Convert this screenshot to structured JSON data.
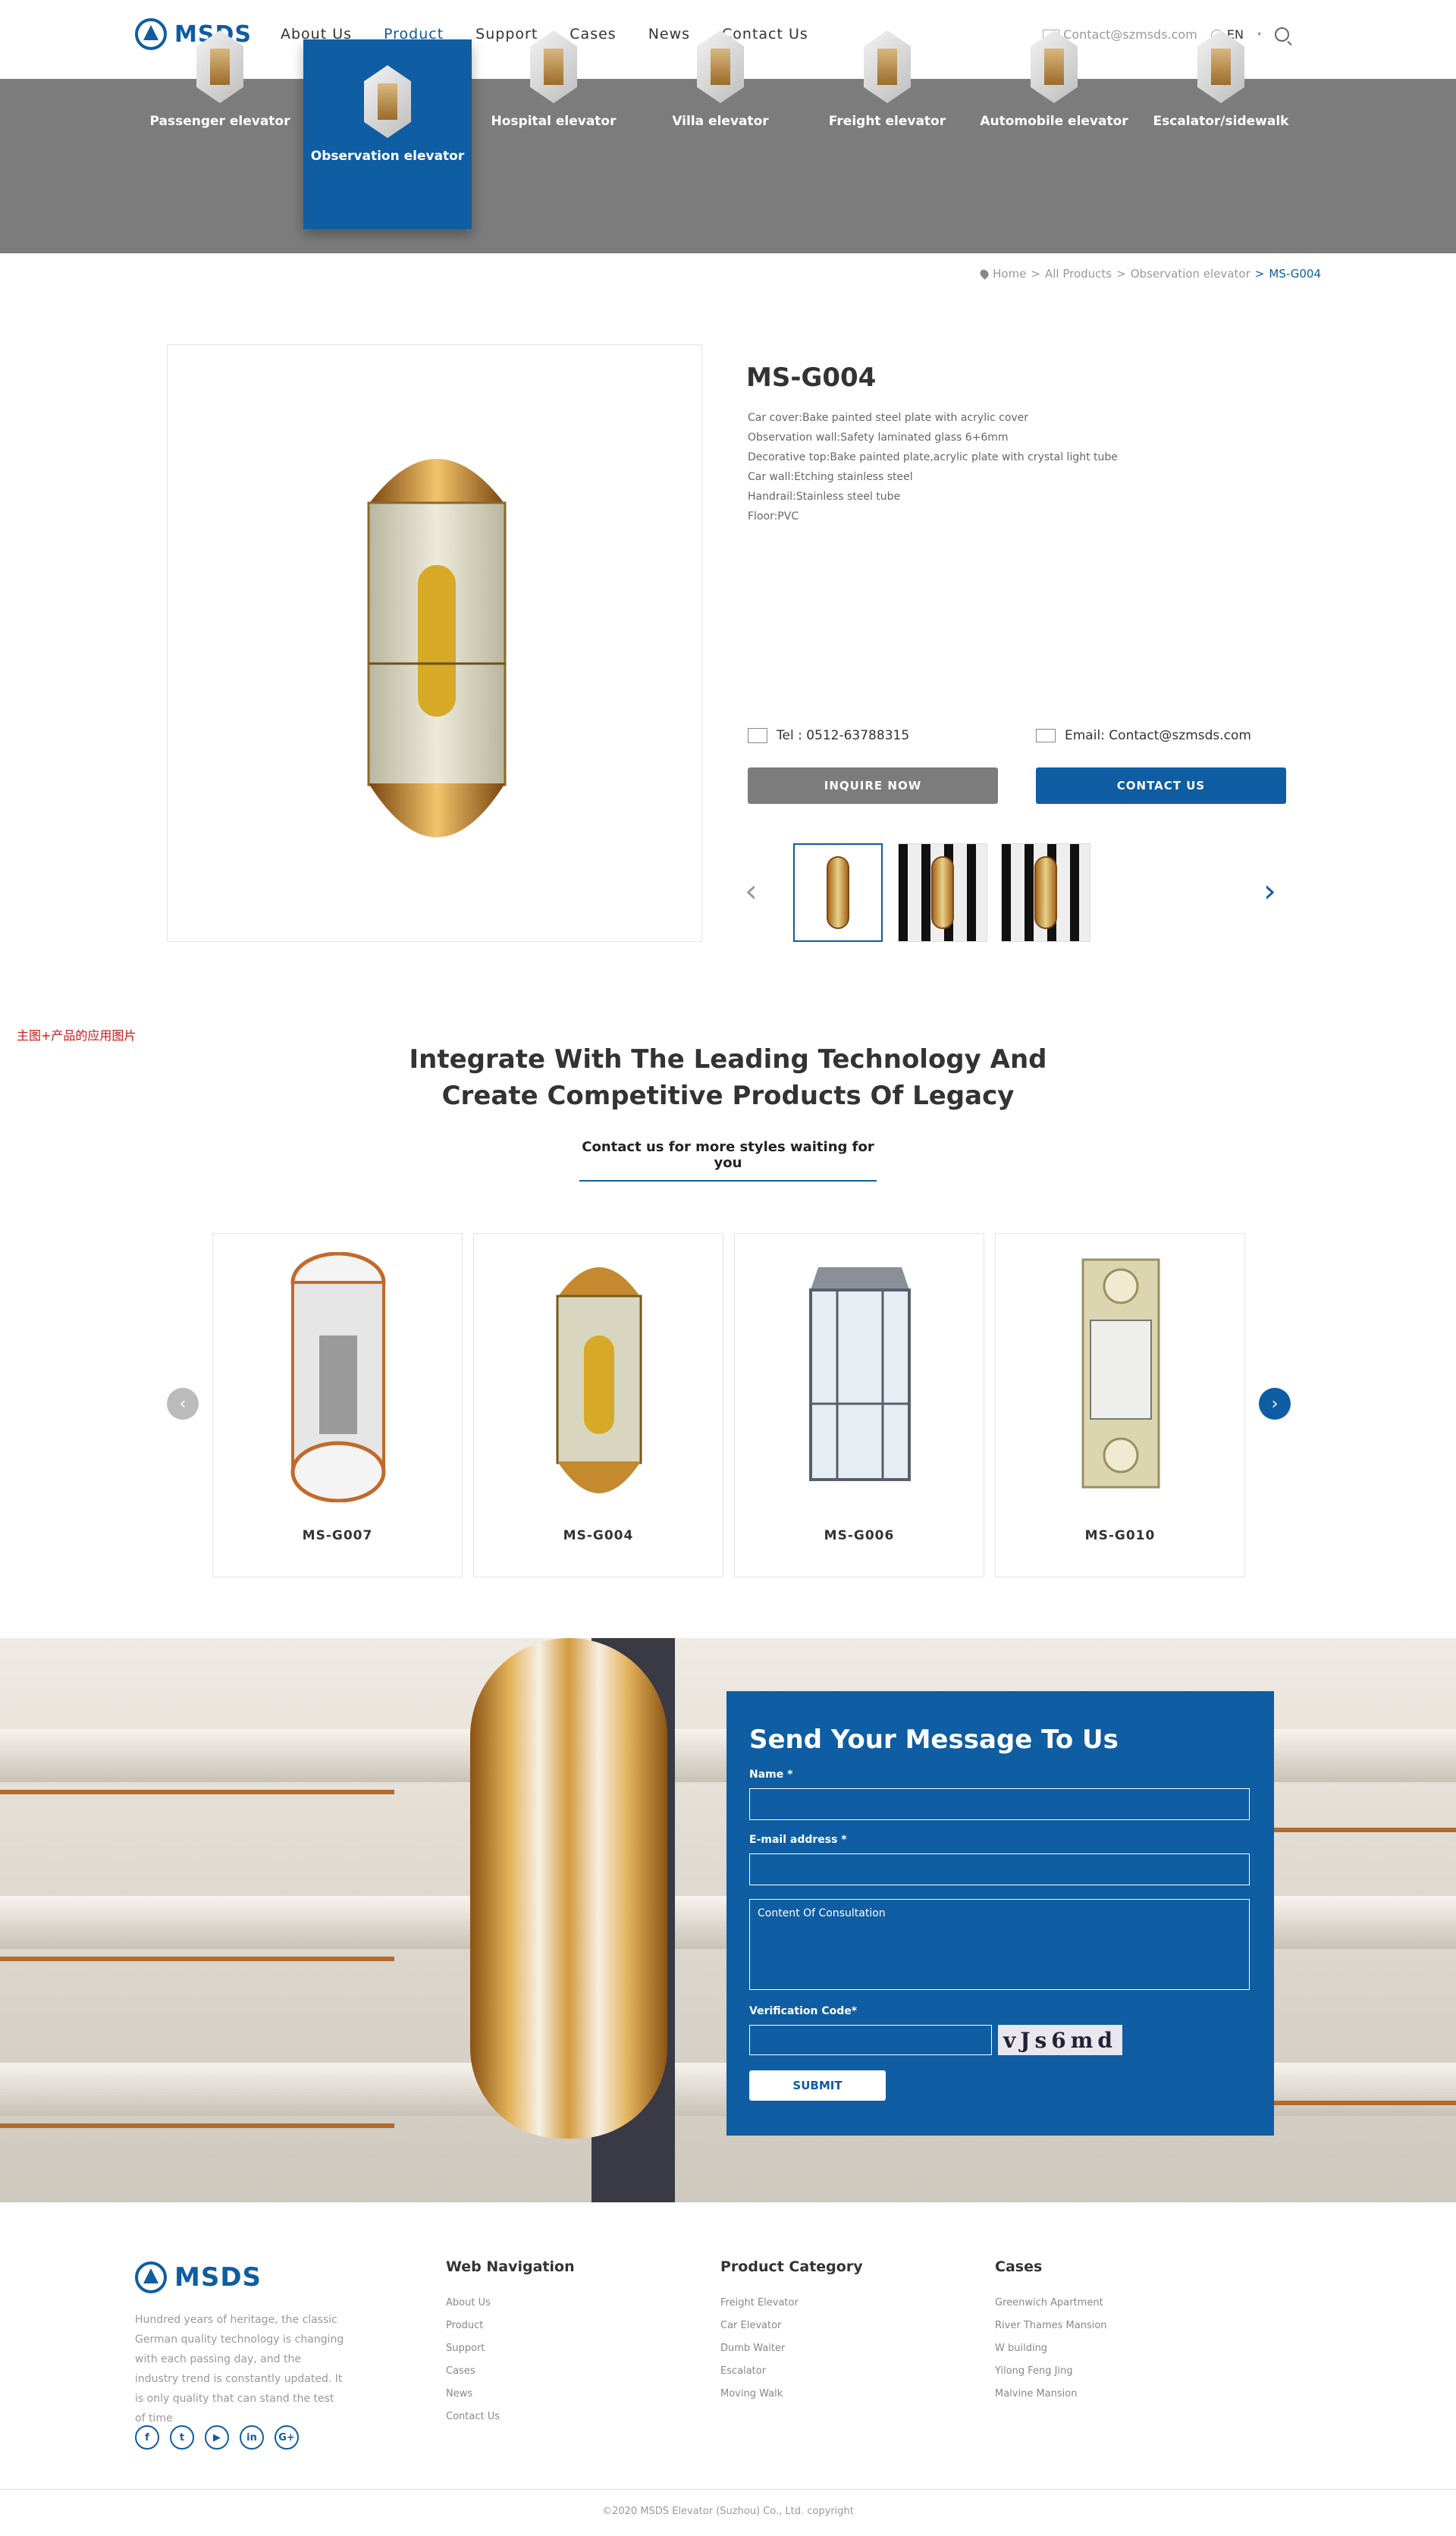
{
  "header": {
    "logo_text": "MSDS",
    "nav": [
      "About Us",
      "Product",
      "Support",
      "Cases",
      "News",
      "Contact Us"
    ],
    "active_nav": "Product",
    "email": "Contact@szmsds.com",
    "lang": "EN"
  },
  "categories": [
    {
      "label": "Passenger elevator"
    },
    {
      "label": "Observation elevator",
      "active": true
    },
    {
      "label": "Hospital elevator"
    },
    {
      "label": "Villa elevator"
    },
    {
      "label": "Freight elevator"
    },
    {
      "label": "Automobile elevator"
    },
    {
      "label": "Escalator/sidewalk"
    }
  ],
  "breadcrumb": {
    "items": [
      "Home",
      "All Products",
      "Observation elevator"
    ],
    "current": "MS-G004",
    "sep": ">"
  },
  "product": {
    "title": "MS-G004",
    "specs": [
      "Car cover:Bake painted steel plate with acrylic cover",
      "Observation wall:Safety laminated glass 6+6mm",
      "Decorative top:Bake painted plate,acrylic plate with crystal light tube",
      "Car wall:Etching stainless steel",
      "Handrail:Stainless steel tube",
      "Floor:PVC"
    ],
    "tel": "Tel : 0512-63788315",
    "email": "Email: Contact@szmsds.com",
    "inquire_label": "INQUIRE NOW",
    "contact_label": "CONTACT US"
  },
  "annotation": "主图+产品的应用图片",
  "section": {
    "title_line1": "Integrate With The Leading Technology And",
    "title_line2": "Create Competitive Products Of Legacy",
    "subtitle": "Contact us for more styles waiting for you"
  },
  "related": [
    {
      "name": "MS-G007"
    },
    {
      "name": "MS-G004"
    },
    {
      "name": "MS-G006"
    },
    {
      "name": "MS-G010"
    }
  ],
  "form": {
    "title": "Send Your Message To Us",
    "name_label": "Name *",
    "email_label": "E-mail address *",
    "content_placeholder": "Content Of Consultation",
    "code_label": "Verification Code*",
    "captcha": "vJs6md",
    "submit": "SUBMIT"
  },
  "footer": {
    "logo_text": "MSDS",
    "desc": "Hundred years of heritage, the classic German quality technology is changing with each passing day, and the industry trend is constantly updated. It is only quality that can stand the test of time",
    "social": [
      "f",
      "t",
      "▶",
      "in",
      "G+"
    ],
    "nav_title": "Web Navigation",
    "nav_items": [
      "About Us",
      "Product",
      "Support",
      "Cases",
      "News",
      "Contact Us"
    ],
    "cat_title": "Product Category",
    "cat_items": [
      "Freight Elevator",
      "Car Elevator",
      "Dumb Waiter",
      "Escalator",
      "Moving Walk"
    ],
    "cases_title": "Cases",
    "cases_items": [
      "Greenwich Apartment",
      "River Thames Mansion",
      "W building",
      "Yilong Feng Jing",
      "Malvine Mansion"
    ],
    "copyright": "©2020 MSDS Elevator (Suzhou) Co., Ltd. copyright"
  },
  "colors": {
    "brand": "#0f5da2",
    "band": "#7c7c7c"
  }
}
